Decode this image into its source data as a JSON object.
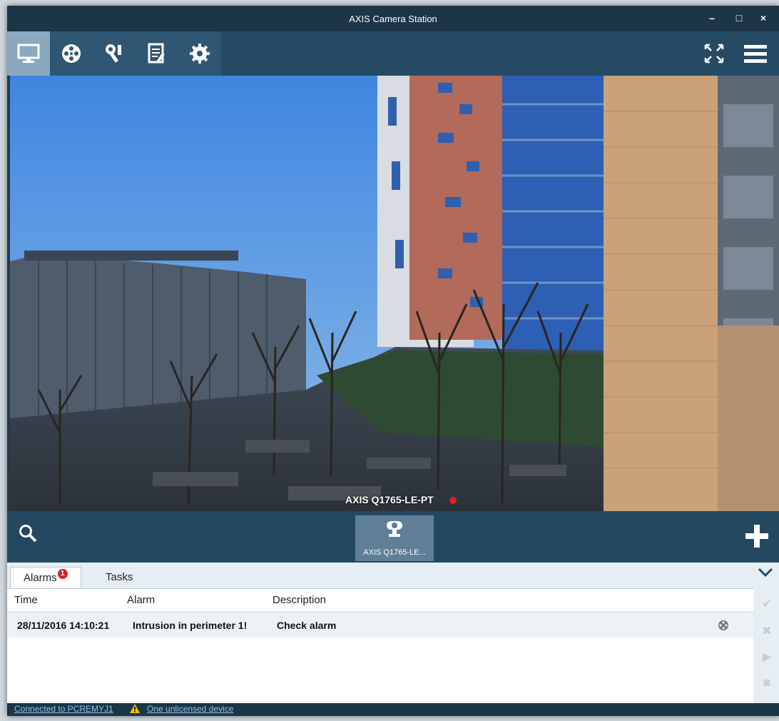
{
  "window": {
    "title": "AXIS Camera Station",
    "minimize": "–",
    "maximize": "□",
    "close": "×"
  },
  "toolbar": {
    "icons": [
      "monitor-icon",
      "film-reel-icon",
      "tools-icon",
      "notes-icon",
      "gear-icon"
    ],
    "right_icons": [
      "fullscreen-icon",
      "menu-icon"
    ]
  },
  "video": {
    "camera_name": "AXIS Q1765-LE-PT",
    "recording": true
  },
  "viewbar": {
    "tile_label": "AXIS Q1765-LE..."
  },
  "panel": {
    "tabs": [
      {
        "label": "Alarms",
        "badge": "1",
        "active": true
      },
      {
        "label": "Tasks",
        "active": false
      }
    ],
    "columns": [
      "Time",
      "Alarm",
      "Description"
    ],
    "rows": [
      {
        "time": "28/11/2016 14:10:21",
        "alarm": "Intrusion in perimeter 1!",
        "description": "Check alarm"
      }
    ]
  },
  "status": {
    "connected": "Connected to PCREMYJ1",
    "warning": "One unlicensed device"
  },
  "colors": {
    "title_bar": "#1c3547",
    "toolbar": "#264a63",
    "active_tab": "#8aa9bf",
    "badge": "#d8202a",
    "link": "#8fc4ef"
  }
}
